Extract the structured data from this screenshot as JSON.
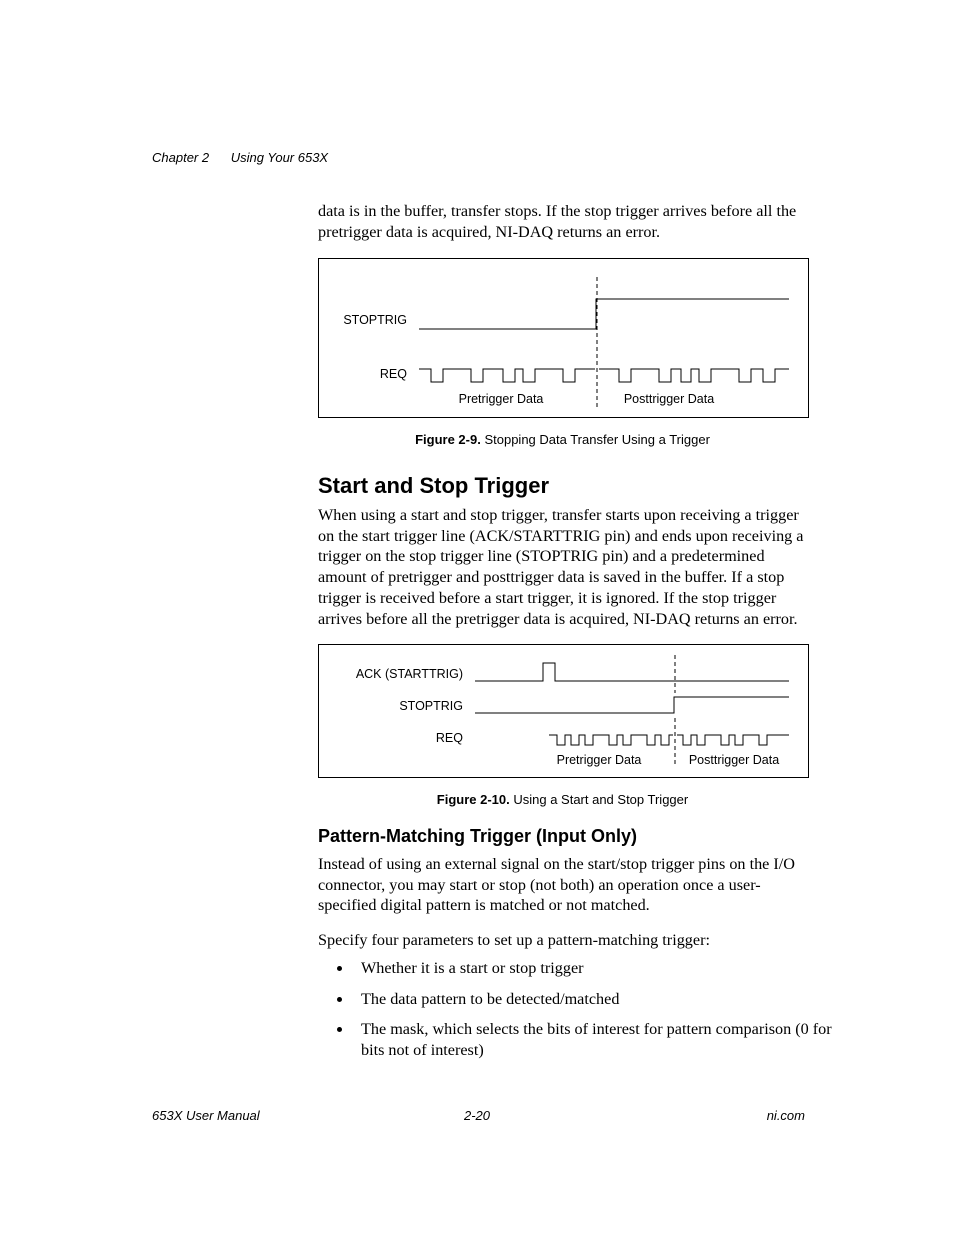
{
  "header": {
    "chapter": "Chapter 2",
    "title": "Using Your 653X"
  },
  "para1": "data is in the buffer, transfer stops. If the stop trigger arrives before all the pretrigger data is acquired, NI-DAQ returns an error.",
  "figure9": {
    "labels": {
      "stoptrig": "STOPTRIG",
      "req": "REQ",
      "pre": "Pretrigger Data",
      "post": "Posttrigger Data"
    },
    "caption_bold": "Figure 2-9.",
    "caption_rest": "  Stopping Data Transfer Using a Trigger"
  },
  "section_heading": "Start and Stop Trigger",
  "para2": "When using a start and stop trigger, transfer starts upon receiving a trigger on the start trigger line (ACK/STARTTRIG pin) and ends upon receiving a trigger on the stop trigger line (STOPTRIG pin) and a predetermined amount of pretrigger and posttrigger data is saved in the buffer. If a stop trigger is received before a start trigger, it is ignored. If the stop trigger arrives before all the pretrigger data is acquired, NI-DAQ returns an error.",
  "figure10": {
    "labels": {
      "ack": "ACK (STARTTRIG)",
      "stoptrig": "STOPTRIG",
      "req": "REQ",
      "pre": "Pretrigger Data",
      "post": "Posttrigger Data"
    },
    "caption_bold": "Figure 2-10.",
    "caption_rest": "  Using a Start and Stop Trigger"
  },
  "subsection_heading": "Pattern-Matching Trigger (Input Only)",
  "para3": "Instead of using an external signal on the start/stop trigger pins on the I/O connector, you may start or stop (not both) an operation once a user-specified digital pattern is matched or not matched.",
  "para4": "Specify four parameters to set up a pattern-matching trigger:",
  "bullets": {
    "b1": "Whether it is a start or stop trigger",
    "b2": "The data pattern to be detected/matched",
    "b3": "The mask, which selects the bits of interest for pattern comparison (0 for bits not of interest)"
  },
  "footer": {
    "left": "653X User Manual",
    "center": "2-20",
    "right": "ni.com"
  }
}
